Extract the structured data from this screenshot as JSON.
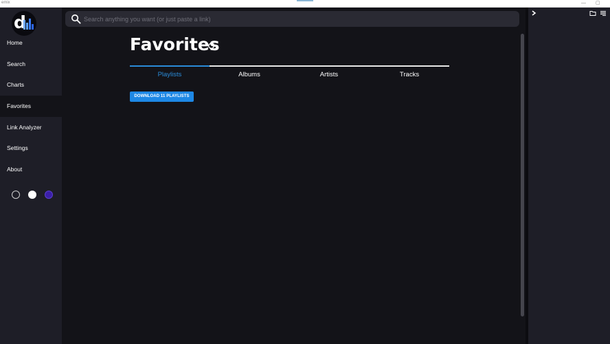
{
  "window": {
    "title": "emix",
    "controls": {
      "minimize": "—",
      "maximize": "▢"
    }
  },
  "sidebar": {
    "logo": {
      "letter": "d",
      "bar_colors": [
        "#6fa8ff",
        "#5aa0ff",
        "#3b7dff",
        "#2c64e6",
        "#6a7dff"
      ]
    },
    "items": [
      {
        "label": "Home",
        "active": false
      },
      {
        "label": "Search",
        "active": false
      },
      {
        "label": "Charts",
        "active": false
      },
      {
        "label": "Favorites",
        "active": true
      },
      {
        "label": "Link Analyzer",
        "active": false
      },
      {
        "label": "Settings",
        "active": false
      },
      {
        "label": "About",
        "active": false
      }
    ],
    "themes": [
      {
        "name": "dark",
        "color": "#1e1e27",
        "border": "#cfcfcf"
      },
      {
        "name": "light",
        "color": "#ffffff",
        "border": "#ffffff"
      },
      {
        "name": "purple",
        "color": "#3b1fa8",
        "border": "#5a3fd0"
      }
    ]
  },
  "search": {
    "placeholder": "Search anything you want (or just paste a link)",
    "value": ""
  },
  "main": {
    "title": "Favorites",
    "tabs": [
      {
        "label": "Playlists",
        "active": true
      },
      {
        "label": "Albums",
        "active": false
      },
      {
        "label": "Artists",
        "active": false
      },
      {
        "label": "Tracks",
        "active": false
      }
    ],
    "download_button": "DOWNLOAD 11 PLAYLISTS"
  },
  "colors": {
    "accent": "#2a8bd8",
    "button": "#1e88e5",
    "background": "#131318",
    "sidebar": "#1e1e27"
  },
  "right_panel": {
    "icons": [
      "chevron-right-icon",
      "folder-icon",
      "list-icon"
    ]
  }
}
